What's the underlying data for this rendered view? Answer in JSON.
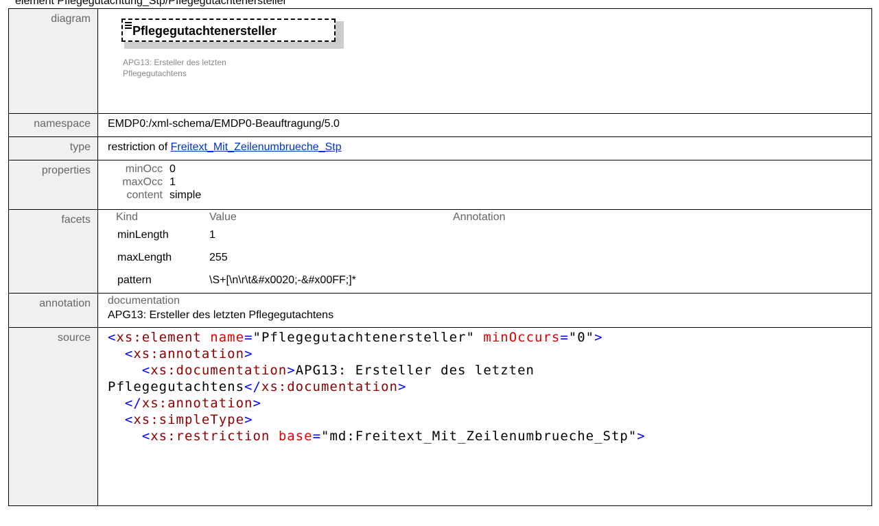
{
  "page_caption": "element Pflegegutachtung_Stp/Pflegegutachtenersteller",
  "labels": {
    "diagram": "diagram",
    "namespace": "namespace",
    "type": "type",
    "properties": "properties",
    "facets": "facets",
    "annotation": "annotation",
    "source": "source"
  },
  "diagram": {
    "element_name": "Pflegegutachtenersteller",
    "note_line1": "APG13: Ersteller des letzten",
    "note_line2": "Pflegegutachtens"
  },
  "namespace_value": "EMDP0:/xml-schema/EMDP0-Beauftragung/5.0",
  "type": {
    "prefix": "restriction of ",
    "link": "Freitext_Mit_Zeilenumbrueche_Stp"
  },
  "properties": [
    {
      "key": "minOcc",
      "value": "0"
    },
    {
      "key": "maxOcc",
      "value": "1"
    },
    {
      "key": "content",
      "value": "simple"
    }
  ],
  "facets": {
    "headers": {
      "kind": "Kind",
      "value": "Value",
      "annotation": "Annotation"
    },
    "rows": [
      {
        "kind": "minLength",
        "value": "1"
      },
      {
        "kind": "maxLength",
        "value": "255"
      },
      {
        "kind": "pattern",
        "value": "\\S+[\\n\\r\\t&#x0020;-&#x00FF;]*"
      }
    ]
  },
  "annotation": {
    "heading": "documentation",
    "text": "APG13: Ersteller des letzten Pflegegutachtens"
  },
  "source": {
    "el_open": "xs:element",
    "name_attr": "name",
    "name_val": "\"Pflegegutachtenersteller\"",
    "minocc_attr": "minOccurs",
    "minocc_val": "\"0\"",
    "annotation_tag": "xs:annotation",
    "documentation_tag": "xs:documentation",
    "doc_text_1": "APG13: Ersteller des letzten",
    "doc_text_2": "Pflegegutachtens",
    "simpletype_tag": "xs:simpleType",
    "restriction_tag": "xs:restriction",
    "base_attr": "base",
    "base_val": "\"md:Freitext_Mit_Zeilenumbrueche_Stp\""
  }
}
